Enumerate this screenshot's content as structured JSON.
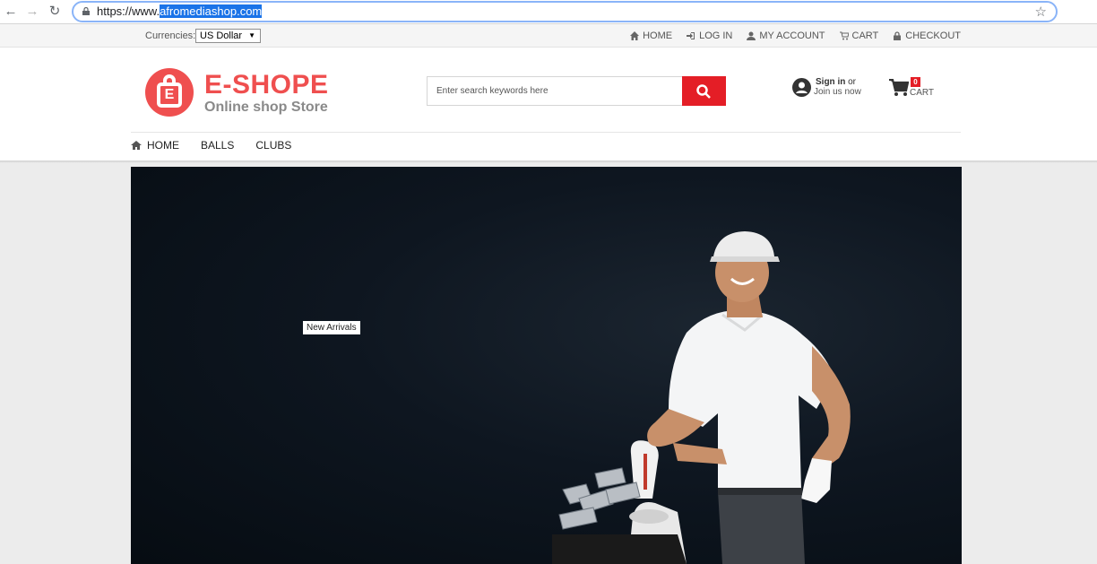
{
  "browser": {
    "url_prefix": "https://www.",
    "url_selected": "afromediashop.com"
  },
  "topbar": {
    "currency_label": "Currencies:",
    "currency_value": "US Dollar",
    "links": [
      {
        "label": "HOME",
        "icon": "home-icon"
      },
      {
        "label": "LOG IN",
        "icon": "login-icon"
      },
      {
        "label": "MY ACCOUNT",
        "icon": "user-icon"
      },
      {
        "label": "CART",
        "icon": "cart-icon"
      },
      {
        "label": "CHECKOUT",
        "icon": "lock-icon"
      }
    ]
  },
  "header": {
    "logo_title": "E-SHOPE",
    "logo_subtitle": "Online shop Store",
    "logo_mark": "E",
    "search_placeholder": "Enter search keywords here",
    "signin_bold": "Sign in",
    "signin_or": "or",
    "join": "Join us now",
    "cart_count": "0",
    "cart_label": "CART"
  },
  "nav": {
    "items": [
      "HOME",
      "BALLS",
      "CLUBS"
    ]
  },
  "hero": {
    "tag": "New Arrivals"
  },
  "colors": {
    "brand_red": "#ef4f4f",
    "search_red": "#e41e26",
    "hero_dark": "#0e1620"
  }
}
